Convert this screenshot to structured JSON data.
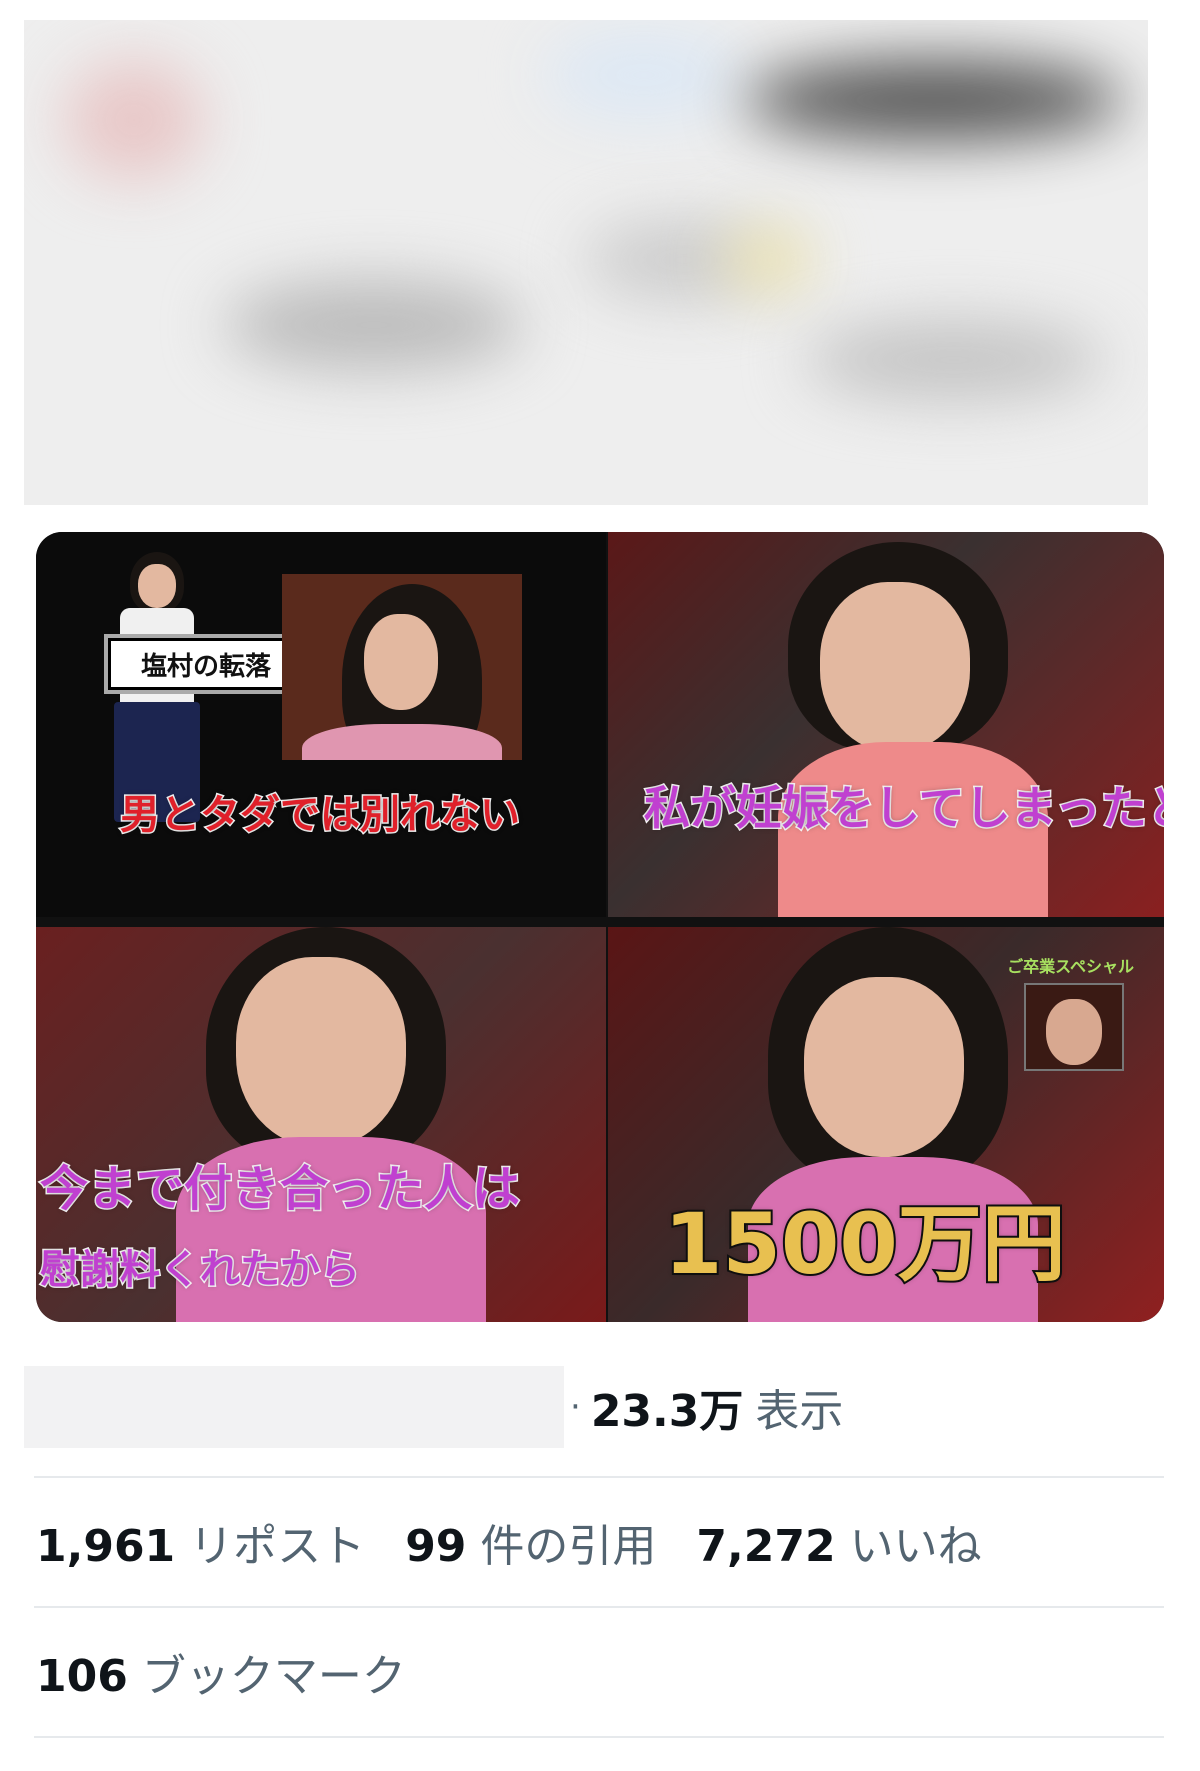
{
  "tweet_media": {
    "panels": [
      {
        "caption": "男とタダでは別れない",
        "inset_label": "塩村の転落",
        "caption_color": "#e0202a"
      },
      {
        "caption": "私が妊娠をしてしまったと",
        "caption_color": "#c040d0"
      },
      {
        "caption": "今まで付き合った人は",
        "caption_sub": "慰謝料くれたから",
        "caption_color": "#c040d0"
      },
      {
        "caption": "1500万円",
        "corner_label": "ご卒業スペシャル",
        "caption_color": "#e8c050"
      }
    ]
  },
  "stats": {
    "views_count": "23.3万",
    "views_label": "表示",
    "reposts_count": "1,961",
    "reposts_label": "リポスト",
    "quotes_count": "99",
    "quotes_label": "件の引用",
    "likes_count": "7,272",
    "likes_label": "いいね",
    "bookmarks_count": "106",
    "bookmarks_label": "ブックマーク"
  }
}
